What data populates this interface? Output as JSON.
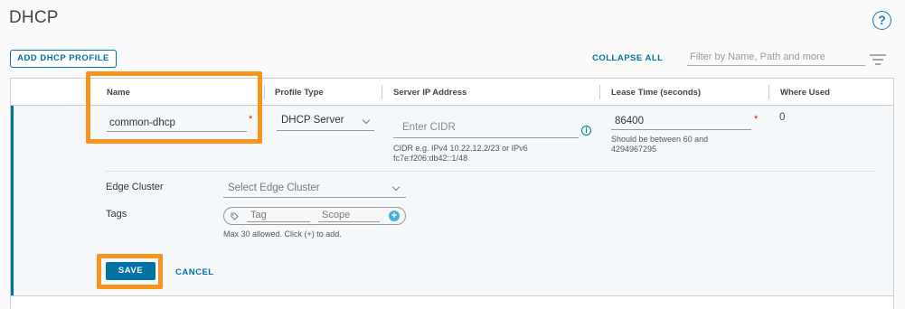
{
  "page": {
    "title": "DHCP"
  },
  "toolbar": {
    "add_label": "ADD DHCP PROFILE",
    "collapse_label": "COLLAPSE ALL",
    "filter_placeholder": "Filter by Name, Path and more"
  },
  "grid": {
    "columns": [
      "Name",
      "Profile Type",
      "Server IP Address",
      "Lease Time (seconds)",
      "Where Used"
    ]
  },
  "form": {
    "name_value": "common-dhcp",
    "profile_type_value": "DHCP Server",
    "server_ip_placeholder": "Enter CIDR",
    "server_ip_helper": "CIDR e.g. IPv4 10.22.12.2/23 or IPv6 fc7e:f206:db42::1/48",
    "lease_time_value": "86400",
    "lease_time_helper": "Should be between 60 and 4294967295",
    "where_used_value": "0",
    "required_mark": "*",
    "edge_cluster_label": "Edge Cluster",
    "edge_cluster_placeholder": "Select Edge Cluster",
    "tags_label": "Tags",
    "tag_placeholder": "Tag",
    "scope_placeholder": "Scope",
    "tags_helper": "Max 30 allowed. Click (+) to add.",
    "save_label": "SAVE",
    "cancel_label": "CANCEL"
  },
  "icons": {
    "help": "help-icon",
    "filter": "filter-icon",
    "info": "info-icon",
    "tag": "tag-icon",
    "plus": "plus-icon",
    "chevron": "chevron-down-icon"
  },
  "colors": {
    "accent": "#0072a3",
    "required": "#c92100",
    "highlight": "#f7941d",
    "row_bg": "#f4f8fb"
  }
}
